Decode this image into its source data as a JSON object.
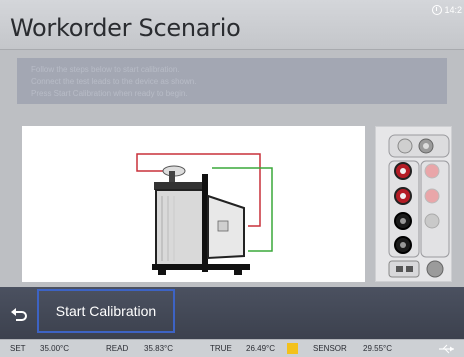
{
  "header": {
    "title": "Workorder Scenario",
    "clock": "14:2"
  },
  "info": {
    "lines": [
      "Follow the steps below to start calibration.",
      "Connect the test leads to the device as shown.",
      "Press Start Calibration when ready to begin."
    ]
  },
  "footer": {
    "start_label": "Start Calibration"
  },
  "status": {
    "set_label": "SET",
    "set_value": "35.00°C",
    "read_label": "READ",
    "read_value": "35.83°C",
    "true_label": "TRUE",
    "true_value": "26.49°C",
    "sensor_label": "SENSOR",
    "sensor_value": "29.55°C"
  },
  "colors": {
    "accent": "#3d63c4",
    "wire_red": "#c9303a",
    "wire_green": "#3aa83a",
    "stable": "#f3c11c"
  }
}
